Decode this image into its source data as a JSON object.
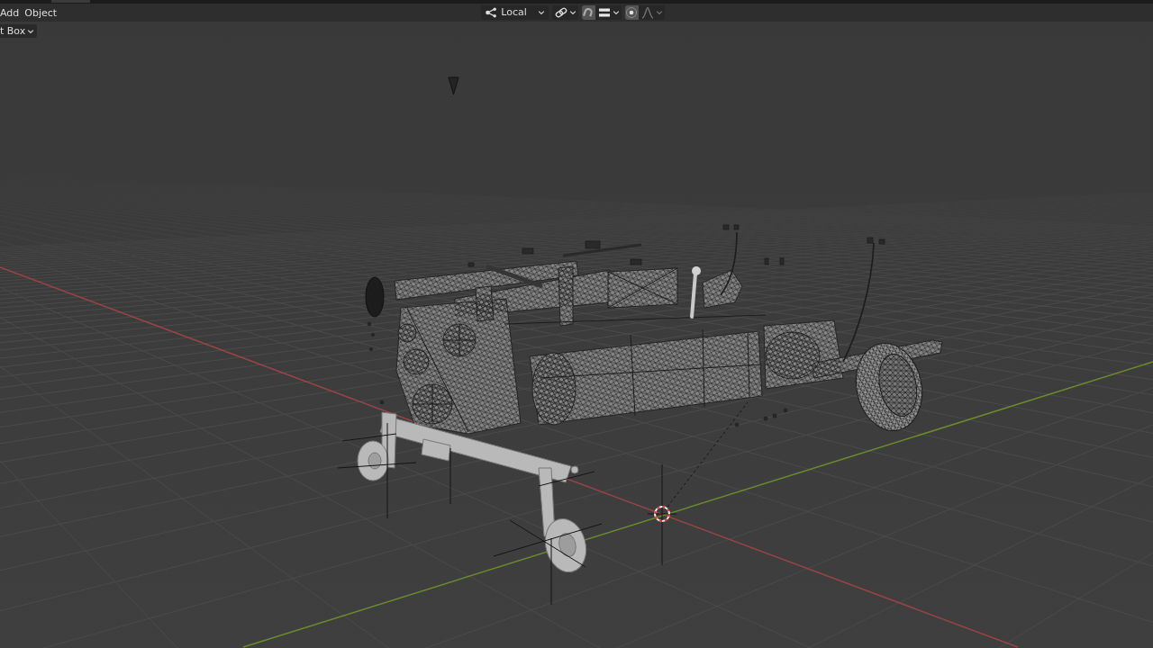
{
  "header": {
    "menus": [
      {
        "label": "Add"
      },
      {
        "label": "Object"
      }
    ],
    "tools": [
      {
        "kind": "orientation",
        "label": "Local",
        "disabled": false
      },
      {
        "kind": "pivot",
        "disabled": false
      },
      {
        "kind": "snap",
        "on": false
      },
      {
        "kind": "snap-target",
        "disabled": false
      },
      {
        "kind": "proportional",
        "on": false
      },
      {
        "kind": "falloff",
        "disabled": true
      }
    ]
  },
  "tool_header": {
    "select_dropdown": {
      "label": "t Box"
    }
  }
}
